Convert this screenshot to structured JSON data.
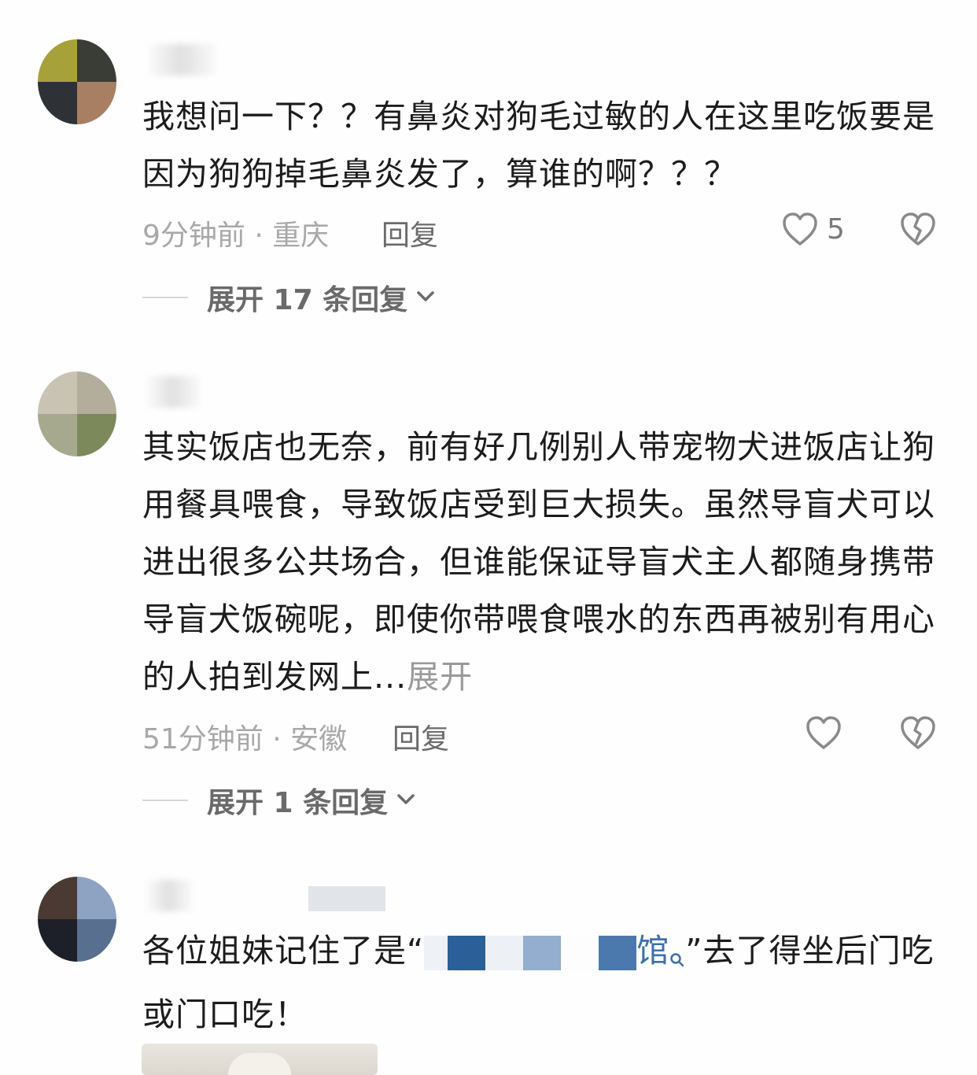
{
  "comments": [
    {
      "text": "我想问一下？？有鼻炎对狗毛过敏的人在这里吃饭要是因为狗狗掉毛鼻炎发了，算谁的啊？？？",
      "time": "9分钟前",
      "location": "重庆",
      "reply_label": "回复",
      "likes": "5",
      "expand_label": "展开 17 条回复"
    },
    {
      "text": "其实饭店也无奈，前有好几例别人带宠物犬进饭店让狗用餐具喂食，导致饭店受到巨大损失。虽然导盲犬可以进出很多公共场合，但谁能保证导盲犬主人都随身携带导盲犬饭碗呢，即使你带喂食喂水的东西再被别有用心的人拍到发网上...",
      "more_label": "展开",
      "time": "51分钟前",
      "location": "安徽",
      "reply_label": "回复",
      "likes": "",
      "expand_label": "展开 1 条回复"
    },
    {
      "text_before": "各位姐妹记住了是“",
      "link_visible": "馆",
      "text_after": "”去了得坐后门吃或门口吃！"
    }
  ],
  "meta_separator": "·",
  "colors": {
    "text": "#1c1c1c",
    "meta": "#a8a8a8",
    "link": "#3d6fa8",
    "icon": "#8a8a8a"
  },
  "icons": [
    "heart-outline-icon",
    "broken-heart-icon",
    "chevron-down-icon",
    "search-icon"
  ]
}
